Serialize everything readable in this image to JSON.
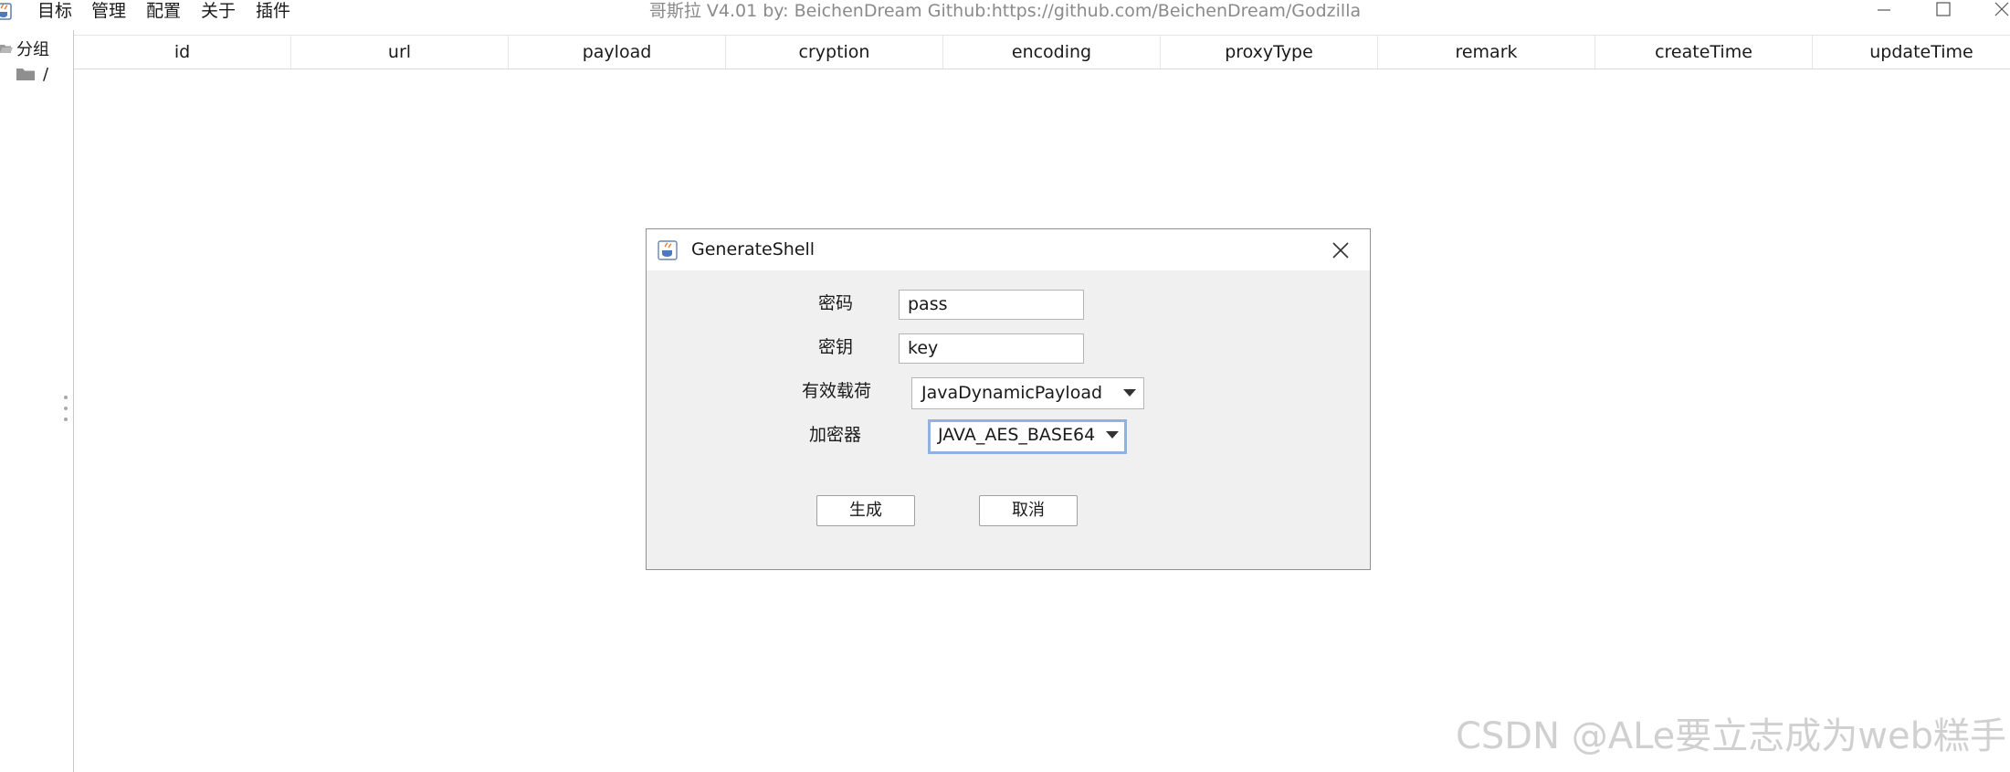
{
  "menu": [
    "目标",
    "管理",
    "配置",
    "关于",
    "插件"
  ],
  "window_title": "哥斯拉    V4.01 by: BeichenDream Github:https://github.com/BeichenDream/Godzilla",
  "tree": {
    "root_label": "分组",
    "child_label": "/"
  },
  "table": {
    "columns": [
      "id",
      "url",
      "payload",
      "cryption",
      "encoding",
      "proxyType",
      "remark",
      "createTime",
      "updateTime"
    ]
  },
  "dialog": {
    "title": "GenerateShell",
    "password_label": "密码",
    "password_value": "pass",
    "key_label": "密钥",
    "key_value": "key",
    "payload_label": "有效载荷",
    "payload_value": "JavaDynamicPayload",
    "cryption_label": "加密器",
    "cryption_value": "JAVA_AES_BASE64",
    "generate_button": "生成",
    "cancel_button": "取消"
  },
  "watermark": "CSDN @ALe要立志成为web糕手",
  "icons": {
    "app": "java-coffee-icon",
    "minimize": "minimize-icon",
    "maximize": "maximize-icon",
    "close": "close-icon",
    "folder": "folder-icon",
    "dropdown": "chevron-down-icon"
  },
  "colors": {
    "dialog_bg": "#f0f0f0",
    "focus_border": "#8db2e3",
    "title_text": "#8a8a8a"
  }
}
